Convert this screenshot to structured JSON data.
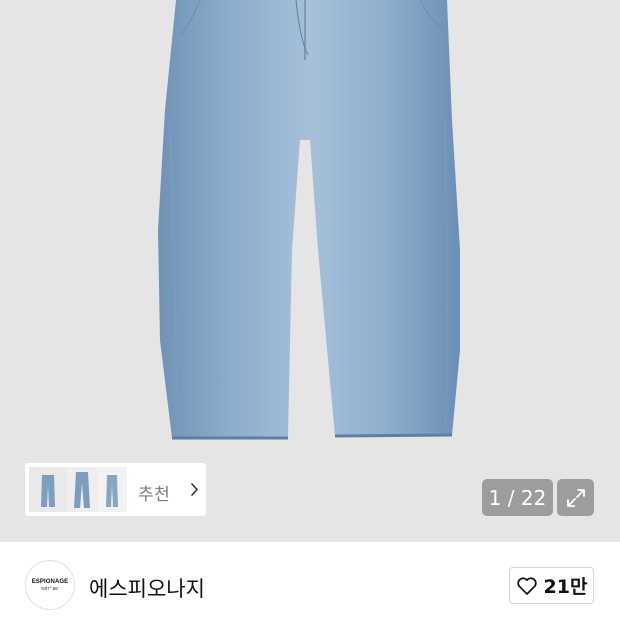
{
  "gallery": {
    "recommend_label": "추천",
    "page_counter": "1 / 22"
  },
  "brand": {
    "logo_text": "ESPIONAGE",
    "logo_sub": "N37° 56'",
    "name": "에스피오나지"
  },
  "like": {
    "count": "21만"
  },
  "icons": {
    "chevron": "chevron-right-icon",
    "expand": "expand-icon",
    "heart": "heart-icon"
  }
}
